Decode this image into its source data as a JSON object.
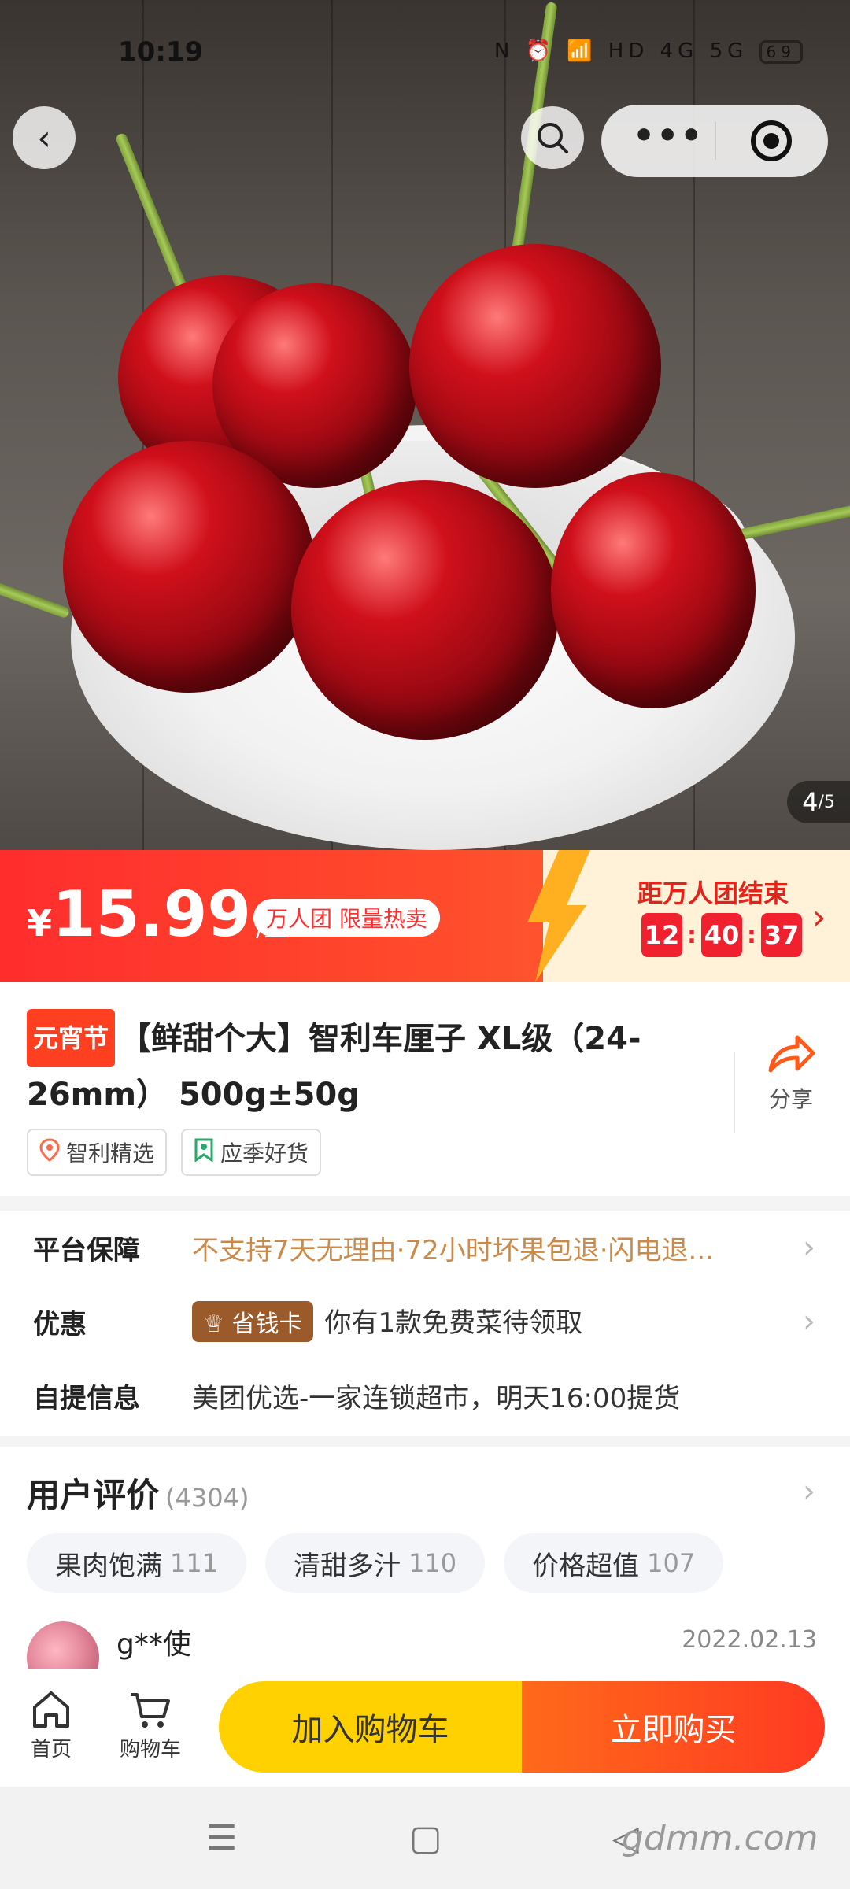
{
  "status_bar": {
    "time": "10:19",
    "icons": "N ⏰ 📶 HD 4G 5G",
    "battery": "69"
  },
  "top_nav": {
    "back_icon": "chevron-left-icon",
    "search_icon": "search-icon",
    "more_icon": "more-dots-icon",
    "close_icon": "target-icon"
  },
  "gallery": {
    "current": "4",
    "total": "/5"
  },
  "price_banner": {
    "currency": "¥",
    "price": "15.99",
    "unit": "/盒",
    "tag": "万人团 限量热卖",
    "countdown_label": "距万人团结束",
    "countdown": {
      "h": "12",
      "m": "40",
      "s": "37"
    }
  },
  "product": {
    "festival_tag": "元宵节",
    "title": "【鲜甜个大】智利车厘子 XL级（24-26mm） 500g±50g",
    "share_label": "分享",
    "chips": [
      "智利精选",
      "应季好货"
    ]
  },
  "info": {
    "guarantee": {
      "label": "平台保障",
      "value": "不支持7天无理由·72小时坏果包退·闪电退..."
    },
    "discount": {
      "label": "优惠",
      "badge": "省钱卡",
      "value": "你有1款免费菜待领取"
    },
    "pickup": {
      "label": "自提信息",
      "value": "美团优选-一家连锁超市，明天16:00提货"
    }
  },
  "reviews": {
    "title": "用户评价",
    "count": "(4304)",
    "tags": [
      {
        "label": "果肉饱满",
        "count": "111"
      },
      {
        "label": "清甜多汁",
        "count": "110"
      },
      {
        "label": "价格超值",
        "count": "107"
      }
    ],
    "first": {
      "name": "g**使",
      "date": "2022.02.13"
    }
  },
  "bottom_bar": {
    "home": "首页",
    "cart": "购物车",
    "add_cart": "加入购物车",
    "buy_now": "立即购买"
  },
  "watermark": "gdmm.com",
  "colors": {
    "accent": "#ff2d2d",
    "cart_yellow": "#ffd100",
    "buy_orange": "#ff4a22"
  }
}
